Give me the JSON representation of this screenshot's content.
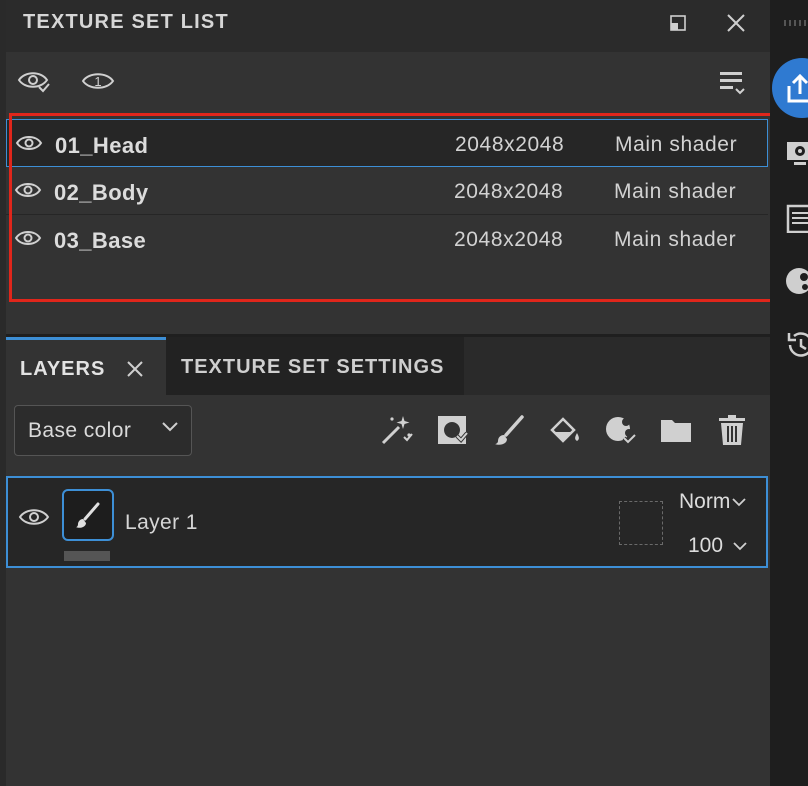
{
  "texture_set_list": {
    "title": "TEXTURE SET LIST",
    "rows": [
      {
        "name": "01_Head",
        "resolution": "2048x2048",
        "shader": "Main shader"
      },
      {
        "name": "02_Body",
        "resolution": "2048x2048",
        "shader": "Main shader"
      },
      {
        "name": "03_Base",
        "resolution": "2048x2048",
        "shader": "Main shader"
      }
    ],
    "solo_badge": "1"
  },
  "tabs": {
    "layers": "LAYERS",
    "texture_set_settings": "TEXTURE SET SETTINGS"
  },
  "layers": {
    "channel": "Base color",
    "items": [
      {
        "name": "Layer 1",
        "blend_mode": "Norm",
        "opacity": "100"
      }
    ]
  },
  "colors": {
    "accent": "#3d8fd6",
    "highlight_box": "#e0261b",
    "panel_bg": "#333333",
    "strip_active": "#2f7ad1"
  },
  "icons": [
    "eye-icon",
    "eye-check-icon",
    "solo-eye-icon",
    "list-settings-icon",
    "popout-icon",
    "close-icon",
    "magic-wand-icon",
    "fill-mask-icon",
    "brush-icon",
    "fill-bucket-icon",
    "smart-material-icon",
    "folder-icon",
    "trash-icon",
    "chevron-down-icon",
    "export-icon",
    "display-settings-icon",
    "notes-icon",
    "shader-icon",
    "history-icon"
  ]
}
